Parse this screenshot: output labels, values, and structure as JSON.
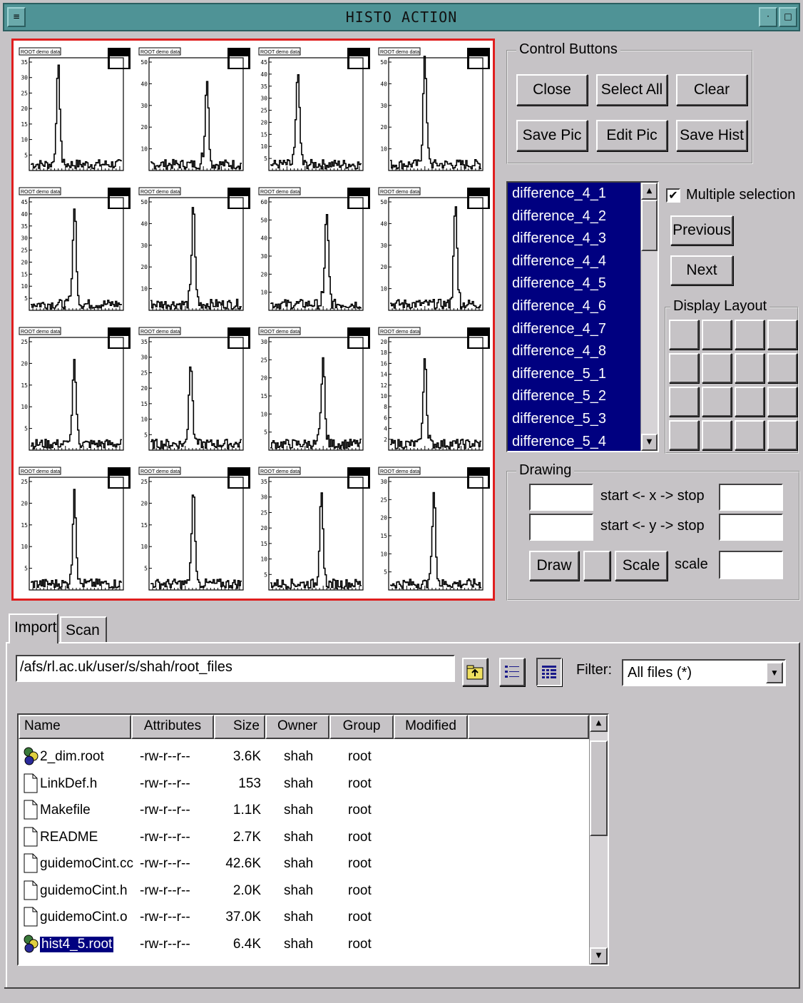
{
  "window": {
    "title": "HISTO ACTION"
  },
  "canvas": {
    "pad_title": "ROOT demo data",
    "rows": [
      {
        "ymax": 35,
        "yticks": [
          5,
          10,
          15,
          20,
          25,
          30,
          35
        ],
        "hists": [
          {
            "ymax": 35,
            "yticks": [
              5,
              10,
              15,
              20,
              25,
              30,
              35
            ],
            "peak_x": 0.3,
            "peak_h": 0.88
          },
          {
            "ymax": 50,
            "yticks": [
              10,
              20,
              30,
              40,
              50
            ],
            "peak_x": 0.62,
            "peak_h": 0.78
          },
          {
            "ymax": 45,
            "yticks": [
              5,
              10,
              15,
              20,
              25,
              30,
              35,
              40,
              45
            ],
            "peak_x": 0.3,
            "peak_h": 0.82
          },
          {
            "ymax": 50,
            "yticks": [
              10,
              20,
              30,
              40,
              50
            ],
            "peak_x": 0.38,
            "peak_h": 0.96
          }
        ]
      },
      {
        "hists": [
          {
            "ymax": 45,
            "yticks": [
              5,
              10,
              15,
              20,
              25,
              30,
              35,
              40,
              45
            ],
            "peak_x": 0.48,
            "peak_h": 0.88
          },
          {
            "ymax": 50,
            "yticks": [
              10,
              20,
              30,
              40,
              50
            ],
            "peak_x": 0.47,
            "peak_h": 0.86
          },
          {
            "ymax": 60,
            "yticks": [
              10,
              20,
              30,
              40,
              50,
              60
            ],
            "peak_x": 0.62,
            "peak_h": 0.82
          },
          {
            "ymax": 50,
            "yticks": [
              10,
              20,
              30,
              40,
              50
            ],
            "peak_x": 0.72,
            "peak_h": 0.88
          }
        ]
      },
      {
        "hists": [
          {
            "ymax": 25,
            "yticks": [
              5,
              10,
              15,
              20,
              25
            ],
            "peak_x": 0.48,
            "peak_h": 0.76
          },
          {
            "ymax": 35,
            "yticks": [
              5,
              10,
              15,
              20,
              25,
              30,
              35
            ],
            "peak_x": 0.44,
            "peak_h": 0.78
          },
          {
            "ymax": 30,
            "yticks": [
              5,
              10,
              15,
              20,
              25,
              30
            ],
            "peak_x": 0.58,
            "peak_h": 0.76
          },
          {
            "ymax": 20,
            "yticks": [
              2,
              4,
              6,
              8,
              10,
              12,
              14,
              16,
              18,
              20
            ],
            "peak_x": 0.38,
            "peak_h": 0.76
          }
        ]
      },
      {
        "hists": [
          {
            "ymax": 25,
            "yticks": [
              5,
              10,
              15,
              20,
              25
            ],
            "peak_x": 0.48,
            "peak_h": 0.82
          },
          {
            "ymax": 25,
            "yticks": [
              5,
              10,
              15,
              20,
              25
            ],
            "peak_x": 0.47,
            "peak_h": 0.82
          },
          {
            "ymax": 35,
            "yticks": [
              5,
              10,
              15,
              20,
              25,
              30,
              35
            ],
            "peak_x": 0.56,
            "peak_h": 0.76
          },
          {
            "ymax": 30,
            "yticks": [
              5,
              10,
              15,
              20,
              25,
              30
            ],
            "peak_x": 0.48,
            "peak_h": 0.82
          }
        ]
      }
    ]
  },
  "control_buttons": {
    "legend": "Control Buttons",
    "close": "Close",
    "select_all": "Select All",
    "clear": "Clear",
    "save_pic": "Save Pic",
    "edit_pic": "Edit Pic",
    "save_hist": "Save Hist"
  },
  "histogram_list": {
    "items": [
      "difference_4_1",
      "difference_4_2",
      "difference_4_3",
      "difference_4_4",
      "difference_4_5",
      "difference_4_6",
      "difference_4_7",
      "difference_4_8",
      "difference_5_1",
      "difference_5_2",
      "difference_5_3",
      "difference_5_4"
    ]
  },
  "selection": {
    "multiple_label": "Multiple selection",
    "multiple_checked": "✔",
    "previous": "Previous",
    "next": "Next"
  },
  "display_layout": {
    "legend": "Display Layout"
  },
  "drawing": {
    "legend": "Drawing",
    "x_range_label": "start <- x -> stop",
    "y_range_label": "start <- y -> stop",
    "draw": "Draw",
    "scale_button": "Scale",
    "scale_label": "scale",
    "x_start": "",
    "x_stop": "",
    "y_start": "",
    "y_stop": "",
    "scale_value": ""
  },
  "tabs": {
    "import": "Import",
    "scan": "Scan"
  },
  "import": {
    "path": "/afs/rl.ac.uk/user/s/shah/root_files",
    "filter_label": "Filter:",
    "filter_value": "All files  (*)"
  },
  "file_table": {
    "columns": [
      "Name",
      "Attributes",
      "Size",
      "Owner",
      "Group",
      "Modified"
    ],
    "rows": [
      {
        "name": "2_dim.root",
        "attributes": "-rw-r--r--",
        "size": "3.6K",
        "owner": "shah",
        "group": "root",
        "icon": "root-file-icon"
      },
      {
        "name": "LinkDef.h",
        "attributes": "-rw-r--r--",
        "size": "153",
        "owner": "shah",
        "group": "root",
        "icon": "document-icon"
      },
      {
        "name": "Makefile",
        "attributes": "-rw-r--r--",
        "size": "1.1K",
        "owner": "shah",
        "group": "root",
        "icon": "document-icon"
      },
      {
        "name": "README",
        "attributes": "-rw-r--r--",
        "size": "2.7K",
        "owner": "shah",
        "group": "root",
        "icon": "document-icon"
      },
      {
        "name": "guidemoCint.cc",
        "attributes": "-rw-r--r--",
        "size": "42.6K",
        "owner": "shah",
        "group": "root",
        "icon": "document-icon"
      },
      {
        "name": "guidemoCint.h",
        "attributes": "-rw-r--r--",
        "size": "2.0K",
        "owner": "shah",
        "group": "root",
        "icon": "document-icon"
      },
      {
        "name": "guidemoCint.o",
        "attributes": "-rw-r--r--",
        "size": "37.0K",
        "owner": "shah",
        "group": "root",
        "icon": "document-icon"
      },
      {
        "name": "hist4_5.root",
        "attributes": "-rw-r--r--",
        "size": "6.4K",
        "owner": "shah",
        "group": "root",
        "icon": "root-file-icon",
        "selected": true
      }
    ]
  },
  "colors": {
    "titlebar": "#4f9396",
    "selection": "#000080",
    "canvas_border": "#e01e1e"
  }
}
